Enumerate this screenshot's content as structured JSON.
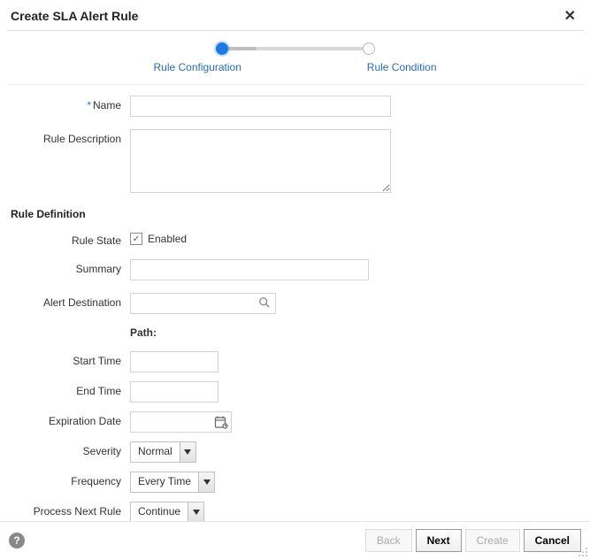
{
  "title": "Create SLA Alert Rule",
  "stepper": {
    "step1": "Rule Configuration",
    "step2": "Rule Condition"
  },
  "fields": {
    "name_label": "Name",
    "rule_description_label": "Rule Description",
    "section_title": "Rule Definition",
    "rule_state_label": "Rule State",
    "rule_state_checkbox_label": "Enabled",
    "summary_label": "Summary",
    "alert_destination_label": "Alert Destination",
    "path_label": "Path:",
    "start_time_label": "Start Time",
    "end_time_label": "End Time",
    "expiration_date_label": "Expiration Date",
    "severity_label": "Severity",
    "frequency_label": "Frequency",
    "process_next_rule_label": "Process Next Rule"
  },
  "values": {
    "name": "",
    "rule_description": "",
    "rule_state_checked": true,
    "summary": "",
    "alert_destination": "",
    "start_time": "",
    "end_time": "",
    "expiration_date": "",
    "severity": "Normal",
    "frequency": "Every Time",
    "process_next_rule": "Continue"
  },
  "buttons": {
    "back": "Back",
    "next": "Next",
    "create": "Create",
    "cancel": "Cancel"
  }
}
